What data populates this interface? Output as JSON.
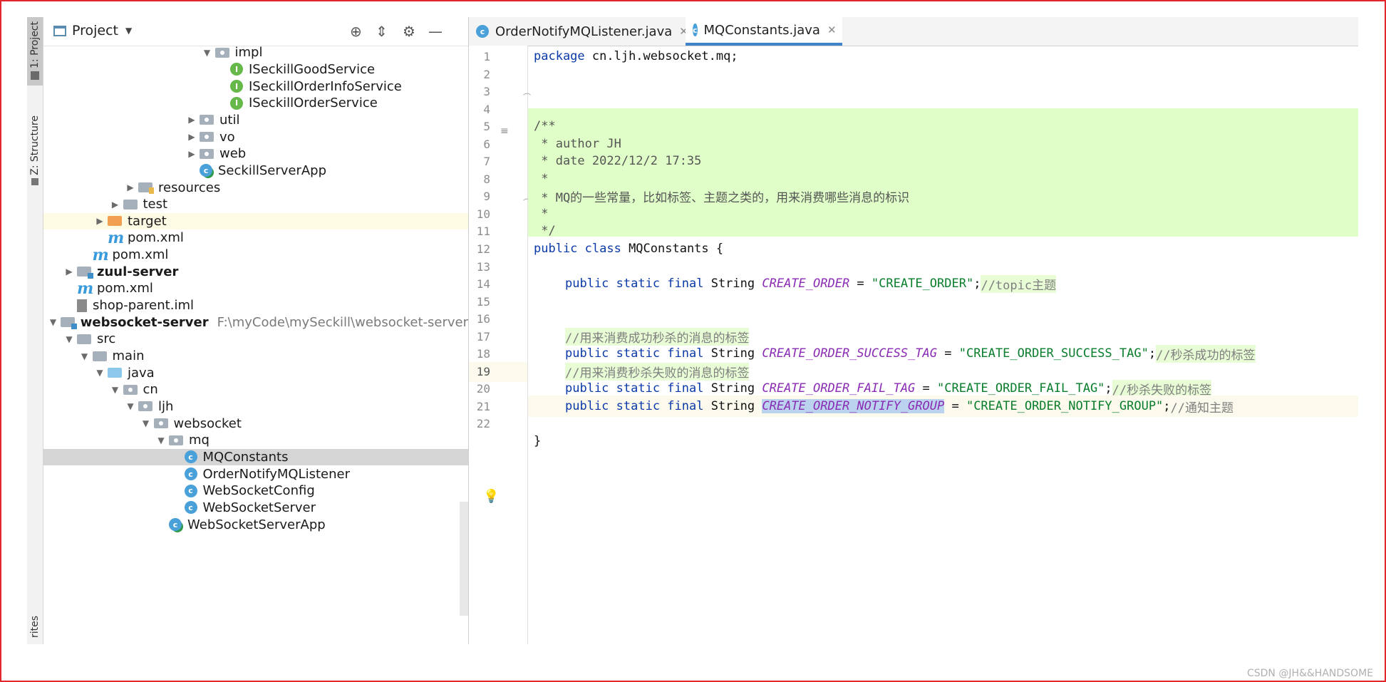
{
  "toolstrip": {
    "project_label": "1: Project",
    "structure_label": "Z: Structure",
    "favorites_label": "rites"
  },
  "project": {
    "title": "Project",
    "tree": [
      {
        "label": "impl",
        "indent": 11,
        "icon": "folder-package",
        "twisty": "expanded"
      },
      {
        "label": "ISeckillGoodService",
        "indent": 12,
        "icon": "interface"
      },
      {
        "label": "ISeckillOrderInfoService",
        "indent": 12,
        "icon": "interface"
      },
      {
        "label": "ISeckillOrderService",
        "indent": 12,
        "icon": "interface"
      },
      {
        "label": "util",
        "indent": 10,
        "icon": "folder-package",
        "twisty": "collapsed"
      },
      {
        "label": "vo",
        "indent": 10,
        "icon": "folder-package",
        "twisty": "collapsed"
      },
      {
        "label": "web",
        "indent": 10,
        "icon": "folder-package",
        "twisty": "collapsed"
      },
      {
        "label": "SeckillServerApp",
        "indent": 10,
        "icon": "app-class"
      },
      {
        "label": "resources",
        "indent": 6,
        "icon": "folder-resources",
        "twisty": "collapsed"
      },
      {
        "label": "test",
        "indent": 5,
        "icon": "folder",
        "twisty": "collapsed"
      },
      {
        "label": "target",
        "indent": 4,
        "icon": "folder-orange",
        "twisty": "collapsed",
        "highlight": true
      },
      {
        "label": "pom.xml",
        "indent": 4,
        "icon": "maven"
      },
      {
        "label": "pom.xml",
        "indent": 3,
        "icon": "maven"
      },
      {
        "label": "zuul-server",
        "indent": 2,
        "icon": "folder-module",
        "twisty": "collapsed",
        "bold": true
      },
      {
        "label": "pom.xml",
        "indent": 2,
        "icon": "maven"
      },
      {
        "label": "shop-parent.iml",
        "indent": 2,
        "icon": "iml-file"
      },
      {
        "label": "websocket-server",
        "indent": 1,
        "icon": "folder-module",
        "twisty": "expanded",
        "bold": true,
        "path": "F:\\myCode\\mySeckill\\websocket-server"
      },
      {
        "label": "src",
        "indent": 2,
        "icon": "folder",
        "twisty": "expanded"
      },
      {
        "label": "main",
        "indent": 3,
        "icon": "folder",
        "twisty": "expanded"
      },
      {
        "label": "java",
        "indent": 4,
        "icon": "folder-blue",
        "twisty": "expanded"
      },
      {
        "label": "cn",
        "indent": 5,
        "icon": "folder-package",
        "twisty": "expanded"
      },
      {
        "label": "ljh",
        "indent": 6,
        "icon": "folder-package",
        "twisty": "expanded"
      },
      {
        "label": "websocket",
        "indent": 7,
        "icon": "folder-package",
        "twisty": "expanded"
      },
      {
        "label": "mq",
        "indent": 8,
        "icon": "folder-package",
        "twisty": "expanded"
      },
      {
        "label": "MQConstants",
        "indent": 9,
        "icon": "class",
        "selected": true
      },
      {
        "label": "OrderNotifyMQListener",
        "indent": 9,
        "icon": "class"
      },
      {
        "label": "WebSocketConfig",
        "indent": 9,
        "icon": "class"
      },
      {
        "label": "WebSocketServer",
        "indent": 9,
        "icon": "class"
      },
      {
        "label": "WebSocketServerApp",
        "indent": 8,
        "icon": "app-class"
      }
    ]
  },
  "editor": {
    "tabs": [
      {
        "label": "OrderNotifyMQListener.java",
        "active": false
      },
      {
        "label": "MQConstants.java",
        "active": true
      }
    ],
    "line_numbers": [
      "1",
      "2",
      "3",
      "4",
      "5",
      "6",
      "7",
      "8",
      "9",
      "10",
      "11",
      "12",
      "13",
      "14",
      "15",
      "16",
      "17",
      "18",
      "19",
      "20",
      "21",
      "22"
    ],
    "current_line": 19,
    "code": {
      "l1_kw": "package",
      "l1_rest": " cn.ljh.websocket.mq;",
      "l3": "/**",
      "l4": " * author JH",
      "l5": " * date 2022/12/2 17:35",
      "l6": " *",
      "l7": " * MQ的一些常量，比如标签、主题之类的，用来消费哪些消息的标识",
      "l8": " *",
      "l9": " */",
      "l10_kw": "public class",
      "l10_rest": " MQConstants {",
      "decl_kw": "public static final",
      "type": " String ",
      "l12_name": "CREATE_ORDER",
      "l12_val": "\"CREATE_ORDER\"",
      "l12_cmt": "//topic主题",
      "l15_cmt": "//用来消费成功秒杀的消息的标签",
      "l16_name": "CREATE_ORDER_SUCCESS_TAG",
      "l16_val": "\"CREATE_ORDER_SUCCESS_TAG\"",
      "l16_cmt": "//秒杀成功的标签",
      "l17_cmt": "//用来消费秒杀失败的消息的标签",
      "l18_name": "CREATE_ORDER_FAIL_TAG",
      "l18_val": "\"CREATE_ORDER_FAIL_TAG\"",
      "l18_cmt": "//秒杀失败的标签",
      "l19_name": "CREATE_ORDER_NOTIFY_GROUP",
      "l19_val": "\"CREATE_ORDER_NOTIFY_GROUP\"",
      "l19_cmt": "//通知主题",
      "l21": "}"
    }
  },
  "watermark": "CSDN @JH&&HANDSOME",
  "colors": {
    "keyword": "#0b3aa8",
    "constant": "#8a2bb3",
    "string": "#0a7d2c",
    "comment": "#7f7f7f",
    "doc_bg": "#e0ffc8",
    "selection": "#bcd3f0",
    "frame": "#e3262b"
  }
}
